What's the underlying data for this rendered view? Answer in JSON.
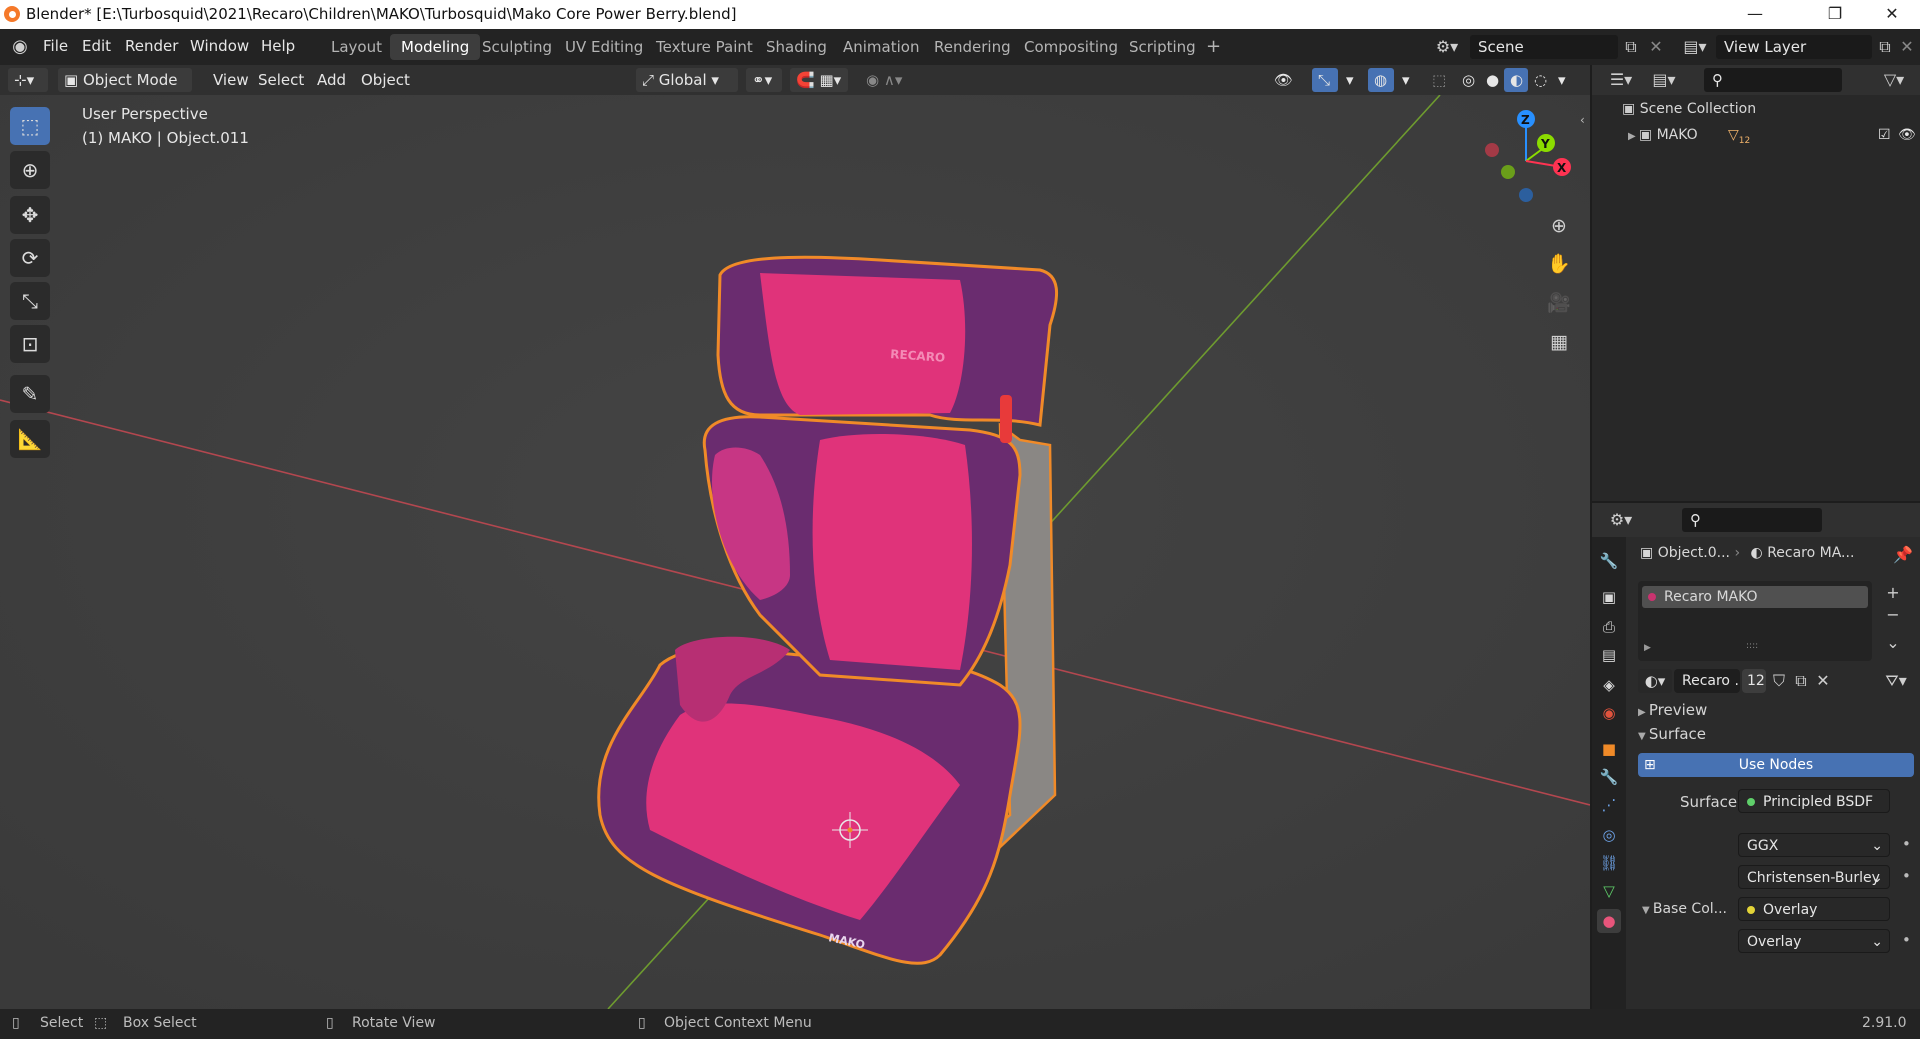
{
  "window": {
    "title": "Blender* [E:\\Turbosquid\\2021\\Recaro\\Children\\MAKO\\Turbosquid\\Mako Core Power Berry.blend]",
    "controls": [
      "—",
      "❐",
      "✕"
    ]
  },
  "menu": [
    "File",
    "Edit",
    "Render",
    "Window",
    "Help"
  ],
  "workspaces": {
    "tabs": [
      "Layout",
      "Modeling",
      "Sculpting",
      "UV Editing",
      "Texture Paint",
      "Shading",
      "Animation",
      "Rendering",
      "Compositing",
      "Scripting"
    ],
    "active": "Modeling",
    "add": "+"
  },
  "scene": {
    "name": "Scene",
    "view_layer": "View Layer"
  },
  "viewport_header": {
    "mode": "Object Mode",
    "menus": [
      "View",
      "Select",
      "Add",
      "Object"
    ],
    "orientation": "Global"
  },
  "viewport": {
    "perspective": "User Perspective",
    "object_info": "(1) MAKO | Object.011",
    "gizmo_axes": [
      "Z",
      "Y",
      "X"
    ],
    "model_logo_text": "RECARO",
    "model_label_text": "MAKO"
  },
  "tools": [
    "select-box",
    "cursor",
    "move",
    "rotate",
    "scale",
    "transform",
    "annotate",
    "measure"
  ],
  "outliner": {
    "root": "Scene Collection",
    "collection": "MAKO",
    "object_count": "12"
  },
  "properties": {
    "object_crumb": "Object.0...",
    "material_crumb": "Recaro MA...",
    "material_slot": "Recaro MAKO",
    "material_name": "Recaro ...",
    "user_count": "12",
    "panels": {
      "preview": "Preview",
      "surface": "Surface"
    },
    "use_nodes": "Use Nodes",
    "surface_label": "Surface",
    "surface_value": "Principled BSDF",
    "distribution": "GGX",
    "subsurface_method": "Christensen-Burley",
    "base_color_label": "Base Col...",
    "base_color_value": "Overlay",
    "blend_type": "Overlay"
  },
  "statusbar": {
    "select": "Select",
    "box_select": "Box Select",
    "rotate": "Rotate View",
    "context": "Object Context Menu",
    "version": "2.91.0"
  },
  "colors": {
    "accent": "#4772b3",
    "selection_outline": "#f08a28",
    "seat_pink": "#e0337a",
    "seat_purple": "#6a2c6f",
    "x_axis": "#ff3352",
    "y_axis": "#8bdc00",
    "z_axis": "#2890ff"
  }
}
